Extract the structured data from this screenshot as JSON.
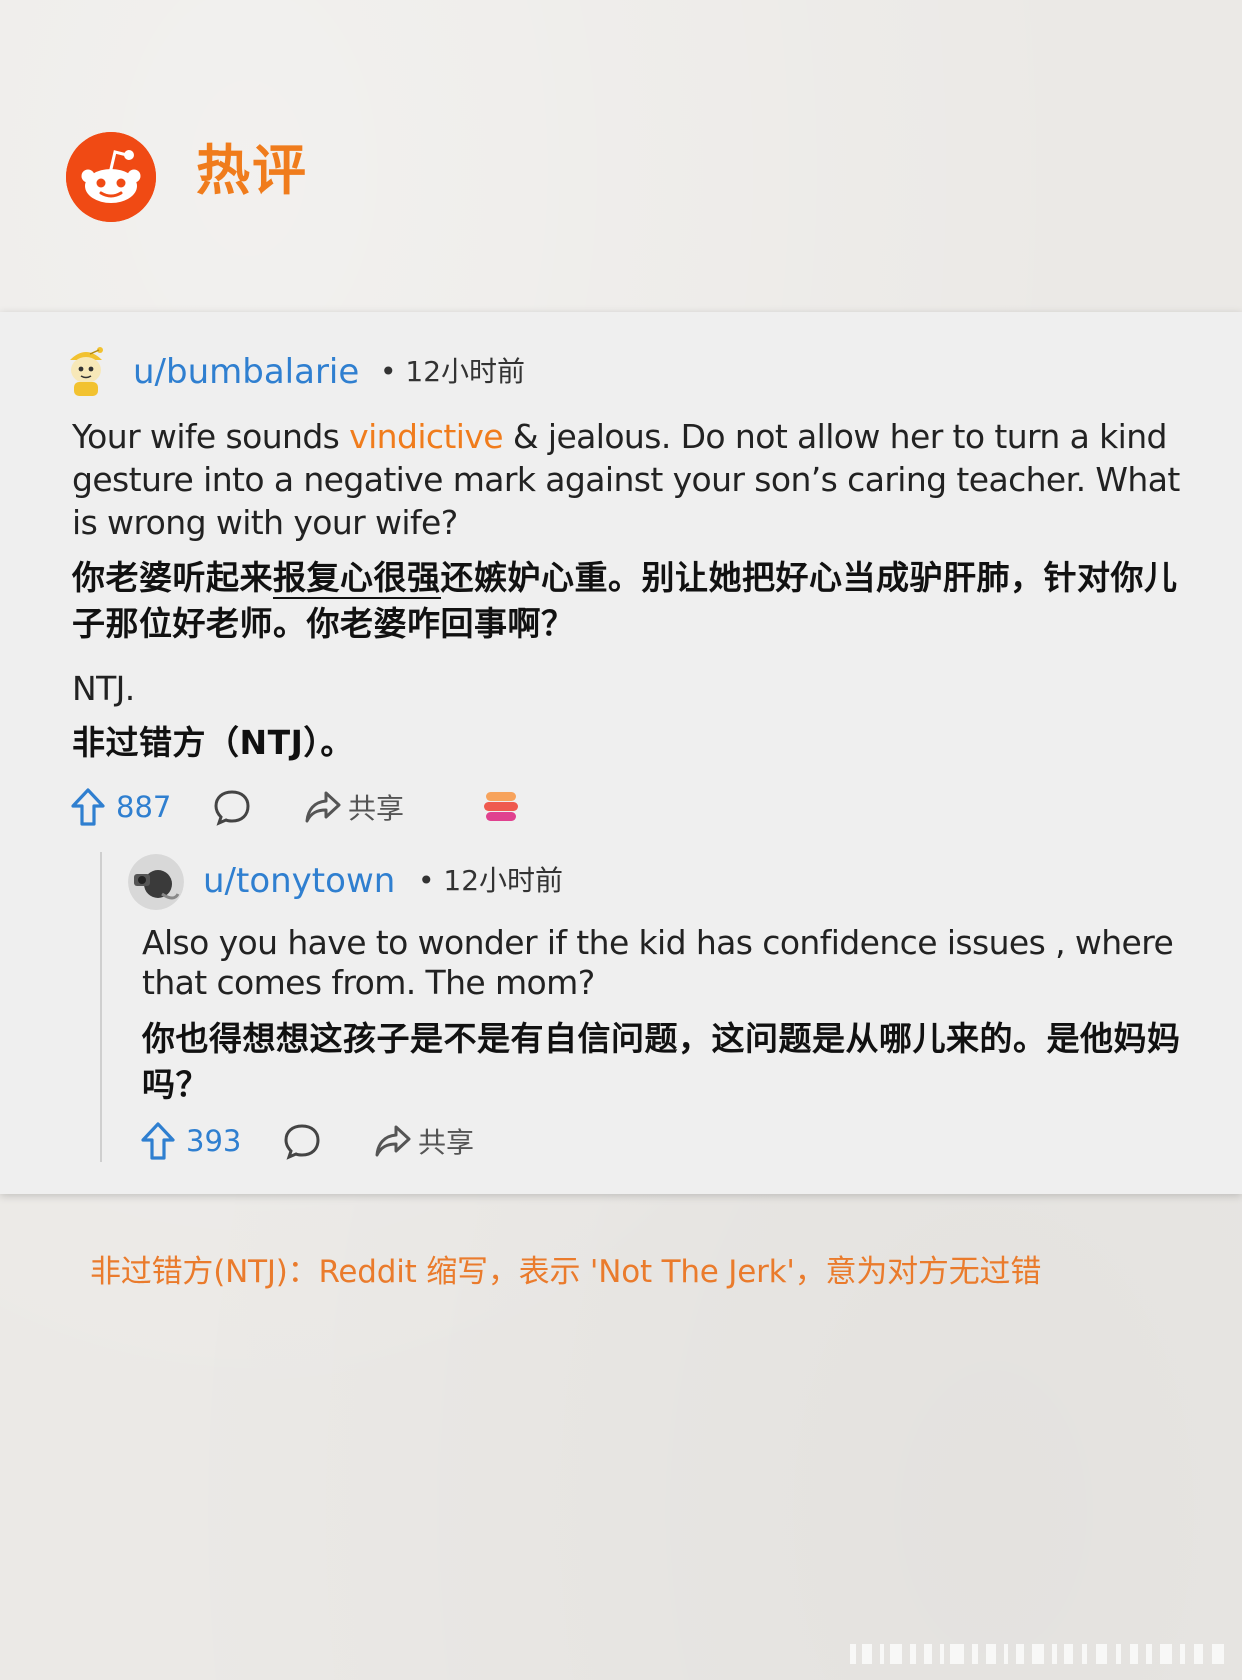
{
  "header": {
    "logo_icon": "reddit-alien-icon",
    "title": "热评",
    "brand_color": "#f04a14",
    "title_color": "#f07c1c"
  },
  "top_comment": {
    "username": "u/bumbalarie",
    "time": "• 12小时前",
    "english": {
      "part1": "Your wife sounds ",
      "highlight": "vindictive",
      "part2": " & jealous. Do not allow her to turn a kind gesture into a negative mark against your son’s caring teacher. What is wrong with your wife?"
    },
    "chinese": {
      "part1": "你老婆听起来",
      "underlined": "报复心很强",
      "part2": "还嫉妒心重。别让她把好心当成驴肝肺，针对你儿子那位好老师。你老婆咋回事啊？"
    },
    "english2": "NTJ.",
    "chinese2": "非过错方（NTJ）。",
    "upvotes": "887",
    "share_label": "共享",
    "award_icon": "award-stack-icon"
  },
  "reply": {
    "username": "u/tonytown",
    "time": "• 12小时前",
    "english": "Also you have to wonder if the kid has confidence issues , where that comes from. The mom?",
    "chinese": "你也得想想这孩子是不是有自信问题，这问题是从哪儿来的。是他妈妈吗？",
    "upvotes": "393",
    "share_label": "共享"
  },
  "footnote": "非过错方(NTJ)：Reddit 缩写，表示 'Not The Jerk'，意为对方无过错",
  "colors": {
    "link_blue": "#2f7fd0",
    "accent_orange": "#f07c1c",
    "card_bg": "#efefef",
    "page_bg": "#ebe9e6"
  }
}
